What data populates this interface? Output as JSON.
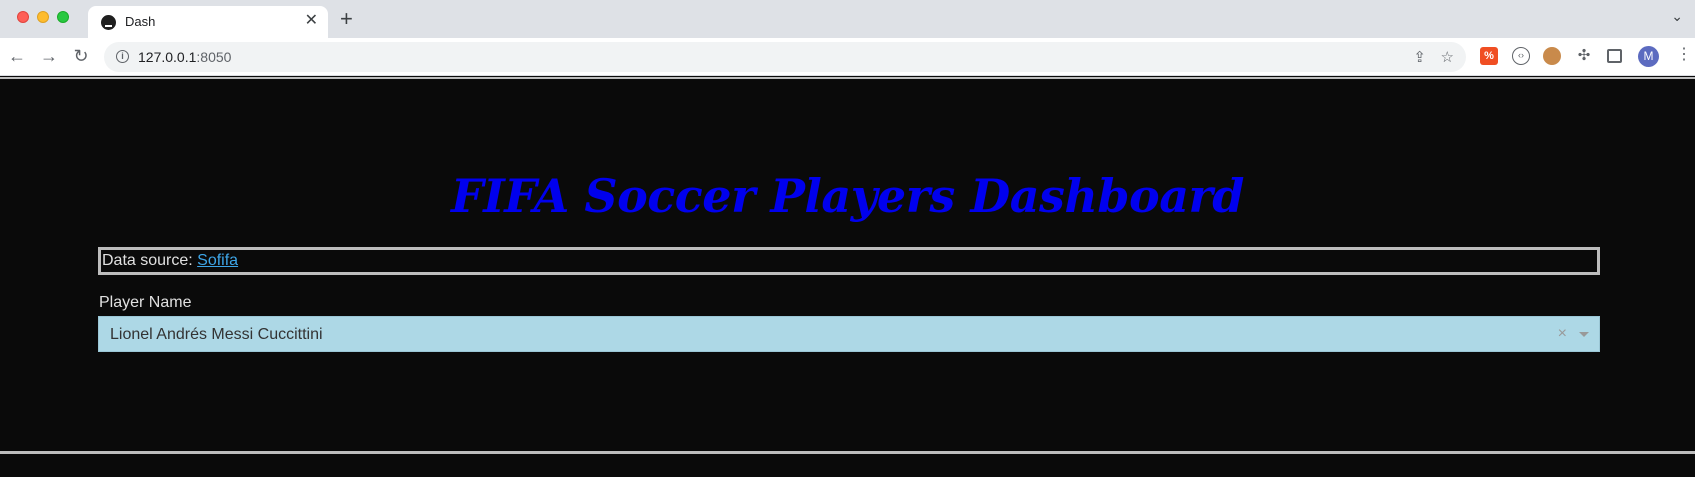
{
  "browser": {
    "tab_title": "Dash",
    "url_host": "127.0.0.1",
    "url_port": ":8050"
  },
  "page": {
    "title": "FIFA Soccer Players Dashboard",
    "source_prefix": "Data source: ",
    "source_link_text": "Sofifa",
    "player_label": "Player Name",
    "player_selected": "Lionel Andrés Messi Cuccittini"
  },
  "colors": {
    "background": "#0a0a0a",
    "title": "#0000ee",
    "link": "#3ea6e8",
    "dropdown_bg": "#add8e6"
  }
}
